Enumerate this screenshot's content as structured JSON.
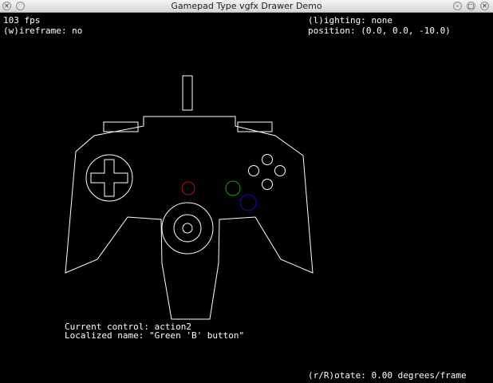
{
  "window": {
    "title": "Gamepad Type vgfx Drawer Demo",
    "icons": {
      "close": "close-icon",
      "left_button": "circle-icon",
      "minimize": "minimize-icon",
      "maximize": "maximize-icon",
      "right_close": "close-icon"
    }
  },
  "hud": {
    "fps": "103 fps",
    "wireframe": "(w)ireframe: no",
    "lighting": "(l)ighting: none",
    "position": "position: (0.0, 0.0, -10.0)",
    "current_control": "Current control: action2",
    "localized_name": "Localized name: \"Green 'B' button\"",
    "rotate": "(r/R)otate: 0.00 degrees/frame"
  },
  "colors": {
    "background": "#000000",
    "outline": "#ffffff",
    "red_button": "#b01010",
    "green_button": "#10a010",
    "blue_button": "#1010c0"
  }
}
